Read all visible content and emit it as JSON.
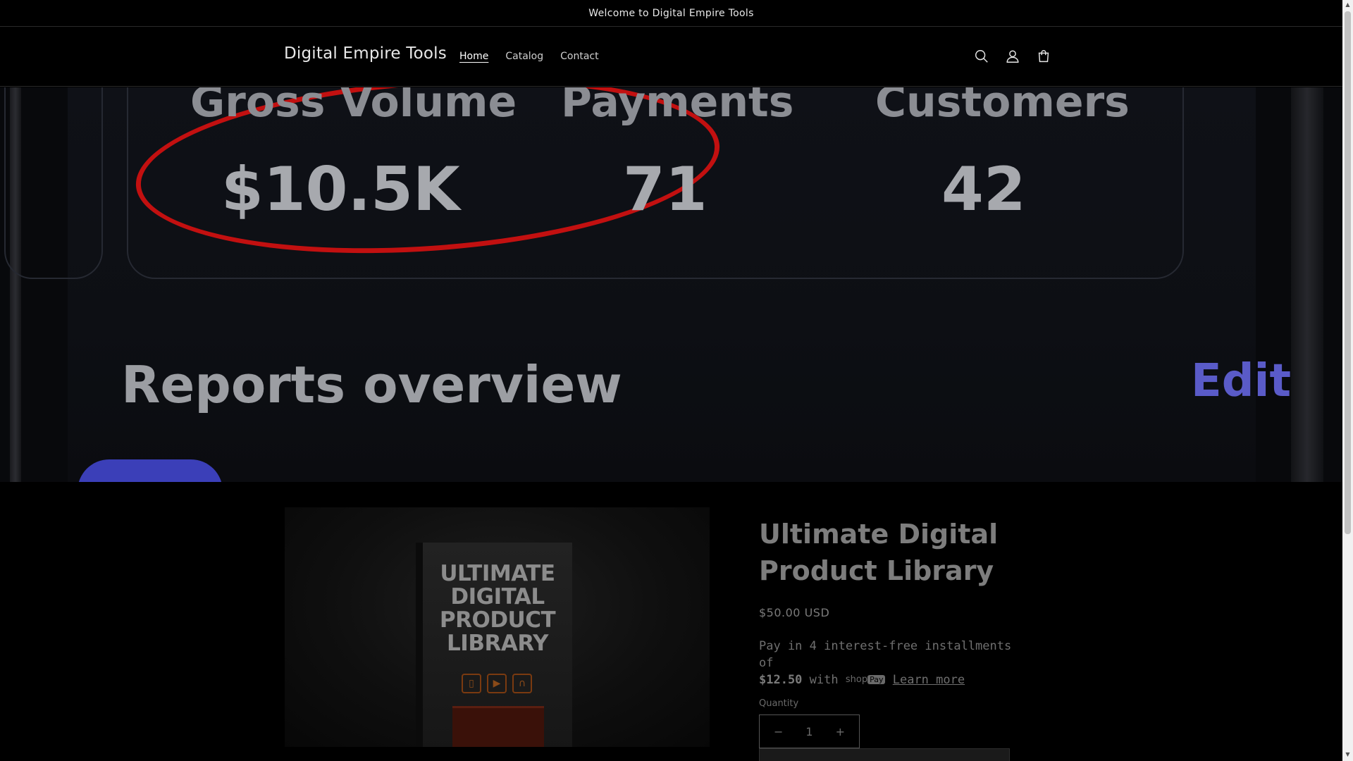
{
  "announcement": {
    "text": "Welcome to Digital Empire Tools"
  },
  "header": {
    "brand": "Digital Empire Tools",
    "nav": [
      {
        "label": "Home",
        "active": true
      },
      {
        "label": "Catalog",
        "active": false
      },
      {
        "label": "Contact",
        "active": false
      }
    ],
    "icons": [
      "search-icon",
      "account-icon",
      "cart-icon"
    ]
  },
  "hero": {
    "stats": [
      {
        "label": "Gross Volume",
        "value": "$10.5K"
      },
      {
        "label": "Payments",
        "value": "71"
      },
      {
        "label": "Customers",
        "value": "42"
      }
    ],
    "reports_title": "Reports overview",
    "edit_label": "Edit",
    "circle_color": "#c21010"
  },
  "product": {
    "image_title": "ULTIMATE DIGITAL PRODUCT LIBRARY",
    "title": "Ultimate Digital Product Library",
    "price": "$50.00 USD",
    "installments_prefix": "Pay in 4 interest-free installments of",
    "installment_amount": "$12.50",
    "installments_with": "with",
    "shop_label": "shop",
    "pay_label": "Pay",
    "learn_more": "Learn more",
    "quantity_label": "Quantity",
    "quantity_value": "1",
    "minus": "−",
    "plus": "+"
  }
}
